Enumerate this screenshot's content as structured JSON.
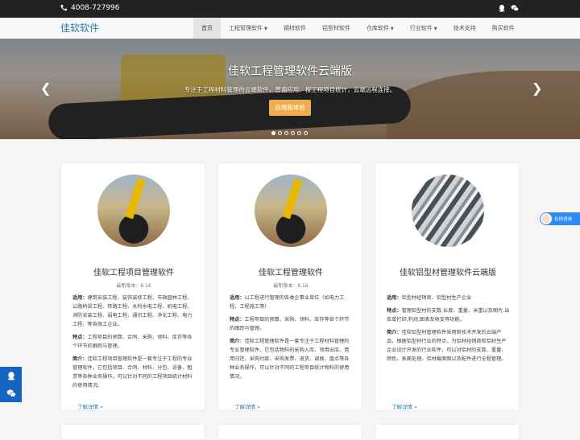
{
  "topbar": {
    "phone": "4008-727996",
    "icons": [
      "qq-icon",
      "wechat-icon"
    ]
  },
  "brand": "佳软软件",
  "nav": [
    {
      "label": "首页",
      "active": true,
      "dropdown": false
    },
    {
      "label": "工程管理软件",
      "dropdown": true
    },
    {
      "label": "钢材软件",
      "dropdown": false
    },
    {
      "label": "铝型材软件",
      "dropdown": false
    },
    {
      "label": "仓库软件",
      "dropdown": true
    },
    {
      "label": "行业软件",
      "dropdown": true
    },
    {
      "label": "技术支持",
      "dropdown": false
    },
    {
      "label": "购买软件",
      "dropdown": false
    }
  ],
  "hero": {
    "title": "佳软工程管理软件云端版",
    "subtitle": "专注于工程材料管理的云端软件，普遍应用、按工程项目统计，云端远程连接。",
    "cta": "云端版体验",
    "slides_total": 6,
    "slide_active": 1
  },
  "cards": [
    {
      "name": "佳软工程项目管理软件",
      "version": "最新版本：6.16",
      "sections": [
        {
          "label": "适用：",
          "text": "建筑安装工程、装饰装修工程、市政园林工程、公路桥梁工程、铁路工程、水利水电工程、机电工程、消防安装工程、弱电工程、通讯工程、净化工程、电力工程、等各施工企业。"
        },
        {
          "label": "特点：",
          "text": "工程项目的预算、合同、采购、领料、库存等各个环节的跟踪与管理。"
        },
        {
          "label": "简介：",
          "text": "佳软工程项目管理软件是一套专注于工程的专业管理软件。它包括项目、合同、材料、分包、设备、租赁等各种业务操作。可以针对不同的工程项目统计材料的使用情况。"
        }
      ],
      "more": "了解详情 »"
    },
    {
      "name": "佳软工程管理软件",
      "version": "最新版本：6.16",
      "sections": [
        {
          "label": "适用：",
          "text": "以工程进行管理的各类企事业单位（如电力工程、工程施工等）"
        },
        {
          "label": "特点：",
          "text": "工程项目的预算、采购、领料、库存等各个环节的跟踪与管理。"
        },
        {
          "label": "简介：",
          "text": "佳软工程管理软件是一套专注于工程材料管理的专业管理软件。它包括物料的采购入库、领用出库、借用归还、采购付款、采购发票、退货、调拨、盘点等各种业务操作，可以针对不同的工程项目统计物料的使用情况。"
        }
      ],
      "more": "了解详情 »"
    },
    {
      "name": "佳软铝型材管理软件云端版",
      "version": "",
      "sections": [
        {
          "label": "适用：",
          "text": "铝型材经销商、铝型材生产企业"
        },
        {
          "label": "特点：",
          "text": "管理铝型材的支数,长度、重量、米重以及图片,出库单打印,利润,图表及收支等功能。"
        },
        {
          "label": "简介：",
          "text": "佳软铝型材管理软件采用新技术开发的云端产品，根据铝型材行业的特点，为铝材经销商和铝材生产企业设计开发的行业软件，可以对铝材的支数、重量、颜色、表面处理、铝材截面图以及配件进行全程管理。"
        }
      ],
      "more": "了解详情 »"
    }
  ],
  "chat": {
    "label": "在线咨询"
  },
  "sidebar": {
    "buttons": [
      "qq-icon",
      "wechat-icon"
    ]
  }
}
